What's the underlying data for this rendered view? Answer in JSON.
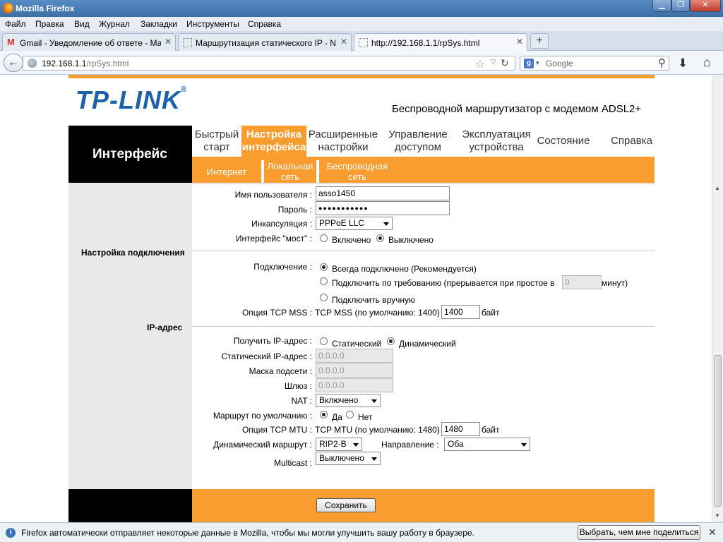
{
  "window": {
    "title": "Mozilla Firefox"
  },
  "menu": [
    "Файл",
    "Правка",
    "Вид",
    "Журнал",
    "Закладки",
    "Инструменты",
    "Справка"
  ],
  "tabs": [
    {
      "label": "Gmail - Уведомление об ответе - Мар...",
      "icon": "gmail-icon"
    },
    {
      "label": "Маршрутизация статического IP - NE...",
      "icon": "page-icon"
    },
    {
      "label": "http://192.168.1.1/rpSys.html",
      "icon": "page-icon"
    }
  ],
  "address": {
    "host": "192.168.1.1",
    "path": "/rpSys.html"
  },
  "search": {
    "engine_letter": "g",
    "placeholder": "Google"
  },
  "header": {
    "logo": "TP-LINK",
    "logo_mark": "®",
    "subtitle": "Беспроводной маршрутизатор с модемом ADSL2+"
  },
  "nav": {
    "section": "Интерфейс",
    "main": [
      {
        "l1": "Быстрый",
        "l2": "старт"
      },
      {
        "l1": "Настройка",
        "l2": "интерфейса"
      },
      {
        "l1": "Расширенные",
        "l2": "настройки"
      },
      {
        "l1": "Управление",
        "l2": "доступом"
      },
      {
        "l1": "Эксплуатация",
        "l2": "устройства"
      },
      {
        "l1": "Состояние",
        "l2": ""
      },
      {
        "l1": "Справка",
        "l2": ""
      }
    ],
    "sub": [
      {
        "l1": "Интернет",
        "l2": ""
      },
      {
        "l1": "Локальная",
        "l2": "сеть"
      },
      {
        "l1": "Беспроводная",
        "l2": "сеть"
      }
    ]
  },
  "sections": {
    "connection": "Настройка подключения",
    "ip": "IP-адрес"
  },
  "form": {
    "username_label": "Имя пользователя :",
    "username_value": "asso1450",
    "password_label": "Пароль :",
    "password_value": "●●●●●●●●●●●",
    "encap_label": "Инкапсуляция :",
    "encap_value": "PPPoE LLC",
    "bridge_label": "Интерфейс \"мост\" :",
    "bridge_on": "Включено",
    "bridge_off": "Выключено",
    "connection_label": "Подключение :",
    "conn_always": "Всегда подключено (Рекомендуется)",
    "conn_demand": "Подключить по требованию (прерывается при простое в",
    "conn_demand_value": "0",
    "conn_demand_unit": "минут)",
    "conn_manual": "Подключить вручную",
    "mss_label": "Опция TCP MSS :",
    "mss_text": "TCP MSS (по умолчанию: 1400)",
    "mss_value": "1400",
    "mss_unit": "байт",
    "get_ip_label": "Получить IP-адрес :",
    "ip_static": "Статический",
    "ip_dynamic": "Динамический",
    "static_ip_label": "Статический IP-адрес :",
    "static_ip_value": "0.0.0.0",
    "mask_label": "Маска подсети :",
    "mask_value": "0.0.0.0",
    "gateway_label": "Шлюз :",
    "gateway_value": "0.0.0.0",
    "nat_label": "NAT :",
    "nat_value": "Включено",
    "default_route_label": "Маршрут по умолчанию :",
    "yes": "Да",
    "no": "Нет",
    "mtu_label": "Опция TCP MTU :",
    "mtu_text": "TCP MTU (по умолчанию: 1480)",
    "mtu_value": "1480",
    "mtu_unit": "байт",
    "dyn_route_label": "Динамический маршрут :",
    "dyn_route_value": "RIP2-B",
    "direction_label": "Направление :",
    "direction_value": "Оба",
    "multicast_label": "Multicast :",
    "multicast_value": "Выключено",
    "save_label": "Сохранить"
  },
  "notification": {
    "message": "Firefox автоматически отправляет некоторые данные в Mozilla, чтобы мы могли улучшить вашу работу в браузере.",
    "button": "Выбрать, чем мне поделиться"
  },
  "colors": {
    "accent": "#f99d31",
    "logo": "#1f61a8",
    "sidebar": "#e9e9e9"
  }
}
